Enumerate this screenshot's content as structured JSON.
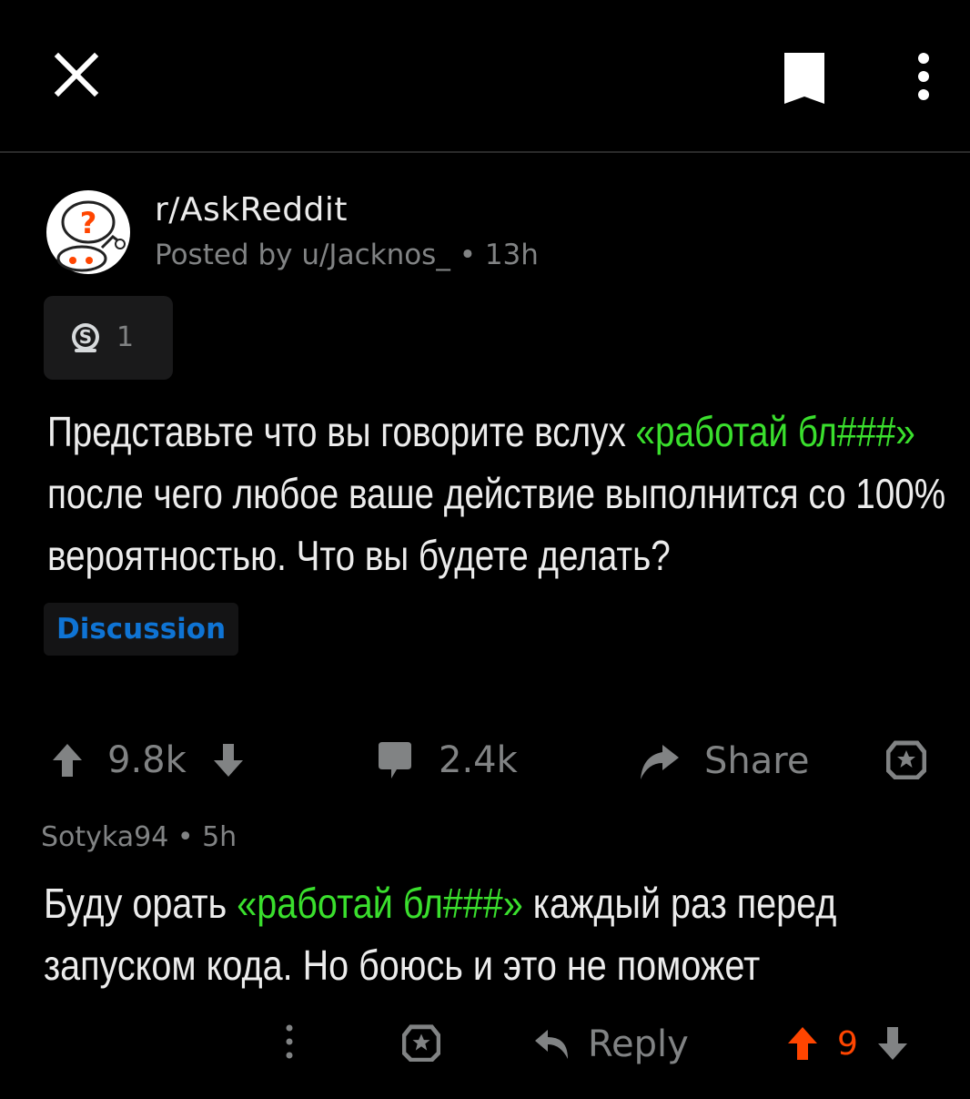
{
  "topbar": {
    "close_icon": "close-icon",
    "bookmark_icon": "bookmark-icon",
    "more_icon": "more-vertical-icon"
  },
  "post": {
    "subreddit": "r/AskReddit",
    "meta": "Posted by u/Jacknos_ • 13h",
    "award_count": "1",
    "title_part1": "Представьте что вы говорите вслух ",
    "title_highlight": "«работай бл###»",
    "title_part2": " после чего любое ваше действие выполнится со 100% вероятностью. Что вы будете делать?",
    "flair": "Discussion",
    "upvotes": "9.8k",
    "comments": "2.4k",
    "share": "Share"
  },
  "comment": {
    "meta": "Sotyka94 • 5h",
    "body_part1": "Буду орать ",
    "body_highlight": "«работай бл###»",
    "body_part2": " каждый раз перед запуском кода. Но боюсь и это не поможет",
    "reply": "Reply",
    "score": "9"
  },
  "colors": {
    "background": "#000000",
    "highlight": "#3adf2d",
    "flair": "#0f74d4",
    "upvote_active": "#ff4500",
    "muted": "#818384"
  }
}
